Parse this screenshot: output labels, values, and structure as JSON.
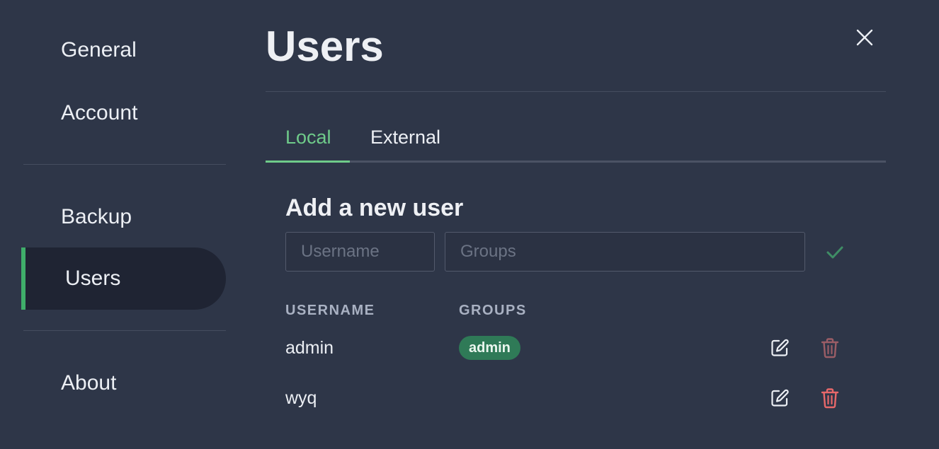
{
  "sidebar": {
    "items": [
      {
        "label": "General"
      },
      {
        "label": "Account"
      },
      {
        "label": "Backup"
      },
      {
        "label": "Users",
        "active": true
      },
      {
        "label": "About"
      }
    ]
  },
  "header": {
    "title": "Users",
    "close_icon": "close-icon"
  },
  "tabs": [
    {
      "label": "Local",
      "active": true
    },
    {
      "label": "External"
    }
  ],
  "add_user": {
    "title": "Add a new user",
    "username_placeholder": "Username",
    "username_value": "",
    "groups_placeholder": "Groups",
    "groups_value": "",
    "confirm_icon": "check-icon"
  },
  "table": {
    "columns": [
      "USERNAME",
      "GROUPS"
    ],
    "rows": [
      {
        "username": "admin",
        "groups": [
          "admin"
        ],
        "delete_enabled": false
      },
      {
        "username": "wyq",
        "groups": [],
        "delete_enabled": true
      }
    ]
  },
  "colors": {
    "background": "#2e3648",
    "accent_green": "#6fcb8a",
    "active_bar": "#3fae6a",
    "badge_bg": "#2f7a57",
    "delete_active": "#e8686a",
    "delete_disabled": "#9b5d66"
  }
}
